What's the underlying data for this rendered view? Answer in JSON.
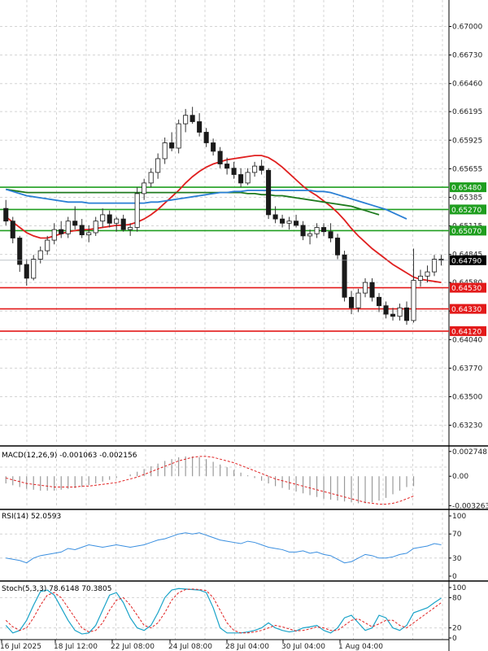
{
  "colors": {
    "bull": "#2e8b57",
    "bear": "#cc1111",
    "ma_red": "#e02020",
    "ma_green": "#1e7a1e",
    "ma_blue": "#2a7fd4",
    "support": "#e31a1a",
    "resistance": "#1f9e1f",
    "macd_hist": "#9a9a9a",
    "macd_signal": "#e02020",
    "rsi_line": "#3a8fe0",
    "stoch_k": "#1aa3c8",
    "stoch_d": "#e02020",
    "grid": "#d4d4d4"
  },
  "chart_data": [
    {
      "type": "candlestick",
      "panel": "price",
      "title": "",
      "price_ticks": [
        "0.67000",
        "0.66730",
        "0.66460",
        "0.66195",
        "0.65925",
        "0.65655",
        "0.65385",
        "0.65115",
        "0.64845",
        "0.64580",
        "0.64310",
        "0.64040",
        "0.63770",
        "0.63500",
        "0.63230"
      ],
      "x_labels": [
        "16 Jul 2025",
        "18 Jul 12:00",
        "22 Jul 08:00",
        "24 Jul 08:00",
        "28 Jul 04:00",
        "30 Jul 04:00",
        "1 Aug 04:00"
      ],
      "current_price": "0.64790",
      "ylim": [
        0.6305,
        0.6725
      ],
      "candles": [
        [
          0.6528,
          0.6536,
          0.6512,
          0.6516
        ],
        [
          0.6516,
          0.652,
          0.6495,
          0.65
        ],
        [
          0.65,
          0.6502,
          0.6468,
          0.6475
        ],
        [
          0.6475,
          0.648,
          0.6455,
          0.6462
        ],
        [
          0.6462,
          0.6484,
          0.646,
          0.648
        ],
        [
          0.648,
          0.6492,
          0.6476,
          0.6488
        ],
        [
          0.6488,
          0.6502,
          0.6484,
          0.6498
        ],
        [
          0.6498,
          0.6514,
          0.6494,
          0.6508
        ],
        [
          0.6508,
          0.6516,
          0.65,
          0.6504
        ],
        [
          0.6504,
          0.652,
          0.65,
          0.6516
        ],
        [
          0.6516,
          0.653,
          0.6508,
          0.6512
        ],
        [
          0.6512,
          0.6518,
          0.65,
          0.6503
        ],
        [
          0.6503,
          0.6512,
          0.6496,
          0.6505
        ],
        [
          0.6505,
          0.652,
          0.6502,
          0.6516
        ],
        [
          0.6516,
          0.6528,
          0.651,
          0.6522
        ],
        [
          0.6522,
          0.6526,
          0.651,
          0.6514
        ],
        [
          0.6514,
          0.652,
          0.6506,
          0.6518
        ],
        [
          0.6518,
          0.6522,
          0.6506,
          0.6508
        ],
        [
          0.6508,
          0.6514,
          0.6502,
          0.651
        ],
        [
          0.651,
          0.6548,
          0.6506,
          0.6542
        ],
        [
          0.6542,
          0.6556,
          0.6536,
          0.6552
        ],
        [
          0.6552,
          0.6566,
          0.6548,
          0.6562
        ],
        [
          0.6562,
          0.658,
          0.6556,
          0.6575
        ],
        [
          0.6575,
          0.6595,
          0.657,
          0.659
        ],
        [
          0.659,
          0.66,
          0.6582,
          0.6585
        ],
        [
          0.6585,
          0.6612,
          0.658,
          0.6608
        ],
        [
          0.6608,
          0.6622,
          0.66,
          0.6616
        ],
        [
          0.6616,
          0.6624,
          0.6608,
          0.661
        ],
        [
          0.661,
          0.6618,
          0.6596,
          0.66
        ],
        [
          0.66,
          0.6604,
          0.6586,
          0.659
        ],
        [
          0.659,
          0.6594,
          0.6578,
          0.6582
        ],
        [
          0.6582,
          0.6586,
          0.6566,
          0.657
        ],
        [
          0.657,
          0.6576,
          0.656,
          0.6566
        ],
        [
          0.6566,
          0.6572,
          0.6556,
          0.656
        ],
        [
          0.656,
          0.6566,
          0.6548,
          0.6552
        ],
        [
          0.6552,
          0.6566,
          0.655,
          0.6562
        ],
        [
          0.6562,
          0.6572,
          0.6558,
          0.6568
        ],
        [
          0.6568,
          0.6574,
          0.656,
          0.6564
        ],
        [
          0.6564,
          0.6566,
          0.6518,
          0.6522
        ],
        [
          0.6522,
          0.653,
          0.6514,
          0.6518
        ],
        [
          0.6518,
          0.6522,
          0.651,
          0.6514
        ],
        [
          0.6514,
          0.652,
          0.6508,
          0.6516
        ],
        [
          0.6516,
          0.6522,
          0.651,
          0.6512
        ],
        [
          0.6512,
          0.6516,
          0.6498,
          0.6502
        ],
        [
          0.6502,
          0.6508,
          0.6494,
          0.6504
        ],
        [
          0.6504,
          0.6514,
          0.65,
          0.651
        ],
        [
          0.651,
          0.6514,
          0.6502,
          0.6506
        ],
        [
          0.6506,
          0.6514,
          0.6496,
          0.65
        ],
        [
          0.65,
          0.6504,
          0.648,
          0.6484
        ],
        [
          0.6484,
          0.6488,
          0.644,
          0.6444
        ],
        [
          0.6444,
          0.645,
          0.6428,
          0.6434
        ],
        [
          0.6434,
          0.6452,
          0.643,
          0.6448
        ],
        [
          0.6448,
          0.6462,
          0.6444,
          0.6458
        ],
        [
          0.6458,
          0.6462,
          0.644,
          0.6444
        ],
        [
          0.6444,
          0.6448,
          0.643,
          0.6436
        ],
        [
          0.6436,
          0.644,
          0.6424,
          0.6428
        ],
        [
          0.6428,
          0.6434,
          0.6422,
          0.6426
        ],
        [
          0.6426,
          0.6438,
          0.6422,
          0.6434
        ],
        [
          0.6434,
          0.644,
          0.6418,
          0.6422
        ],
        [
          0.6422,
          0.649,
          0.642,
          0.646
        ],
        [
          0.646,
          0.647,
          0.6454,
          0.6464
        ],
        [
          0.6464,
          0.6474,
          0.6458,
          0.6468
        ],
        [
          0.6468,
          0.6484,
          0.6464,
          0.648
        ],
        [
          0.648,
          0.6484,
          0.6474,
          0.6479
        ]
      ],
      "moving_averages": [
        {
          "color": "ma_red",
          "values": [
            0.652,
            0.6515,
            0.651,
            0.6505,
            0.6502,
            0.65,
            0.65,
            0.6502,
            0.6504,
            0.6506,
            0.6507,
            0.6508,
            0.6508,
            0.6509,
            0.651,
            0.6511,
            0.6512,
            0.6512,
            0.6513,
            0.6515,
            0.6518,
            0.6522,
            0.6527,
            0.6533,
            0.6539,
            0.6545,
            0.6552,
            0.6558,
            0.6563,
            0.6567,
            0.657,
            0.6572,
            0.6574,
            0.6575,
            0.6576,
            0.6577,
            0.6578,
            0.6578,
            0.6576,
            0.6572,
            0.6567,
            0.6561,
            0.6555,
            0.6549,
            0.6544,
            0.654,
            0.6535,
            0.653,
            0.6524,
            0.6517,
            0.6509,
            0.6502,
            0.6496,
            0.649,
            0.6485,
            0.648,
            0.6475,
            0.6471,
            0.6467,
            0.6463,
            0.6461,
            0.646,
            0.6459,
            0.6458
          ]
        },
        {
          "color": "ma_green",
          "values": [
            0.6546,
            0.6545,
            0.6544,
            0.6543,
            0.6543,
            0.6543,
            0.6543,
            0.6543,
            0.6543,
            0.6543,
            0.6543,
            0.6543,
            0.6543,
            0.6543,
            0.6543,
            0.6543,
            0.6543,
            0.6543,
            0.6543,
            0.6543,
            0.6543,
            0.6543,
            0.6543,
            0.6543,
            0.6543,
            0.6543,
            0.6543,
            0.6543,
            0.6543,
            0.6543,
            0.6543,
            0.6543,
            0.6543,
            0.6543,
            0.6543,
            0.6542,
            0.6542,
            0.6541,
            0.6541,
            0.654,
            0.654,
            0.6539,
            0.6538,
            0.6537,
            0.6536,
            0.6535,
            0.6534,
            0.6533,
            0.6532,
            0.6531,
            0.653,
            0.6528,
            0.6526,
            0.6524,
            0.6522
          ]
        },
        {
          "color": "ma_blue",
          "values": [
            0.6546,
            0.6544,
            0.6542,
            0.654,
            0.6539,
            0.6538,
            0.6537,
            0.6536,
            0.6535,
            0.6534,
            0.6534,
            0.6534,
            0.6533,
            0.6533,
            0.6533,
            0.6533,
            0.6533,
            0.6533,
            0.6533,
            0.6533,
            0.6533,
            0.6534,
            0.6534,
            0.6535,
            0.6536,
            0.6537,
            0.6538,
            0.6539,
            0.654,
            0.6541,
            0.6542,
            0.6543,
            0.6543,
            0.6544,
            0.6544,
            0.6545,
            0.6545,
            0.6545,
            0.6545,
            0.6545,
            0.6545,
            0.6545,
            0.6545,
            0.6545,
            0.6545,
            0.6544,
            0.6544,
            0.6543,
            0.6541,
            0.6539,
            0.6537,
            0.6535,
            0.6533,
            0.6531,
            0.6529,
            0.6527,
            0.6524,
            0.6521,
            0.6518
          ]
        }
      ],
      "levels": [
        {
          "label": "0.65480",
          "value": 0.6548,
          "kind": "resistance"
        },
        {
          "label": "0.65270",
          "value": 0.6527,
          "kind": "resistance"
        },
        {
          "label": "0.65070",
          "value": 0.6507,
          "kind": "resistance"
        },
        {
          "label": "0.64530",
          "value": 0.6453,
          "kind": "support"
        },
        {
          "label": "0.64330",
          "value": 0.6433,
          "kind": "support"
        },
        {
          "label": "0.64120",
          "value": 0.6412,
          "kind": "support"
        }
      ]
    },
    {
      "type": "histogram",
      "panel": "macd",
      "label": "MACD(12,26,9) -0.001063 -0.002156",
      "ticks": [
        "0.002748",
        "0.00",
        "-0.003263"
      ],
      "ylim": [
        -0.0035,
        0.003
      ],
      "histogram": [
        -0.0008,
        -0.001,
        -0.0012,
        -0.0014,
        -0.0015,
        -0.0016,
        -0.0016,
        -0.0016,
        -0.0015,
        -0.0014,
        -0.0013,
        -0.0012,
        -0.001,
        -0.0008,
        -0.0006,
        -0.0004,
        -0.0002,
        0.0,
        0.0002,
        0.0005,
        0.0008,
        0.0011,
        0.0014,
        0.0017,
        0.0019,
        0.0021,
        0.0022,
        0.0022,
        0.0021,
        0.0019,
        0.0016,
        0.0013,
        0.001,
        0.0007,
        0.0004,
        0.0001,
        -0.0002,
        -0.0005,
        -0.0008,
        -0.0011,
        -0.0013,
        -0.0015,
        -0.0017,
        -0.0019,
        -0.0021,
        -0.0023,
        -0.0025,
        -0.0026,
        -0.0027,
        -0.0028,
        -0.0029,
        -0.003,
        -0.003,
        -0.0029,
        -0.0027,
        -0.0024,
        -0.002,
        -0.0016,
        -0.0012,
        -0.0011
      ],
      "signal": [
        -0.0002,
        -0.0004,
        -0.0006,
        -0.0008,
        -0.0009,
        -0.001,
        -0.0011,
        -0.0012,
        -0.0012,
        -0.0012,
        -0.0012,
        -0.0011,
        -0.0011,
        -0.001,
        -0.0009,
        -0.0008,
        -0.0007,
        -0.0005,
        -0.0003,
        -0.0001,
        0.0002,
        0.0005,
        0.0008,
        0.0011,
        0.0014,
        0.0017,
        0.0019,
        0.0021,
        0.0022,
        0.0022,
        0.0021,
        0.0019,
        0.0017,
        0.0015,
        0.0012,
        0.0009,
        0.0006,
        0.0003,
        0.0,
        -0.0003,
        -0.0005,
        -0.0007,
        -0.0009,
        -0.0011,
        -0.0013,
        -0.0015,
        -0.0017,
        -0.0019,
        -0.0021,
        -0.0023,
        -0.0025,
        -0.0027,
        -0.0029,
        -0.003,
        -0.0031,
        -0.0031,
        -0.003,
        -0.0028,
        -0.0025,
        -0.0022
      ]
    },
    {
      "type": "line",
      "panel": "rsi",
      "label": "RSI(14) 52.0593",
      "ticks": [
        "100",
        "70",
        "30",
        "0"
      ],
      "ylim": [
        0,
        100
      ],
      "values": [
        30,
        28,
        26,
        22,
        30,
        34,
        36,
        38,
        40,
        46,
        44,
        48,
        52,
        50,
        48,
        50,
        52,
        50,
        48,
        50,
        52,
        56,
        60,
        62,
        66,
        70,
        72,
        70,
        72,
        68,
        64,
        60,
        58,
        56,
        54,
        58,
        56,
        52,
        48,
        46,
        44,
        40,
        40,
        42,
        38,
        40,
        36,
        34,
        28,
        22,
        24,
        30,
        36,
        34,
        30,
        30,
        32,
        36,
        38,
        46,
        48,
        50,
        54,
        52
      ]
    },
    {
      "type": "line",
      "panel": "stoch",
      "label": "Stoch(5,3,3) 78.6148 70.3805",
      "ticks": [
        "100",
        "80",
        "20",
        "0"
      ],
      "ylim": [
        0,
        100
      ],
      "k": [
        25,
        10,
        15,
        35,
        65,
        92,
        95,
        85,
        60,
        35,
        15,
        8,
        10,
        25,
        55,
        85,
        90,
        70,
        40,
        20,
        15,
        25,
        50,
        80,
        95,
        98,
        97,
        96,
        95,
        90,
        60,
        20,
        10,
        10,
        10,
        12,
        15,
        20,
        30,
        20,
        15,
        12,
        14,
        20,
        22,
        25,
        15,
        10,
        20,
        40,
        45,
        30,
        15,
        20,
        45,
        40,
        20,
        15,
        25,
        50,
        55,
        60,
        70,
        79
      ],
      "d": [
        35,
        22,
        15,
        20,
        40,
        65,
        85,
        90,
        80,
        60,
        40,
        20,
        12,
        15,
        30,
        55,
        75,
        80,
        65,
        45,
        25,
        20,
        30,
        50,
        75,
        90,
        96,
        97,
        96,
        94,
        80,
        55,
        30,
        15,
        10,
        10,
        12,
        15,
        20,
        25,
        22,
        18,
        14,
        15,
        18,
        22,
        20,
        15,
        15,
        25,
        35,
        38,
        30,
        22,
        28,
        35,
        35,
        25,
        20,
        30,
        40,
        50,
        60,
        70
      ]
    }
  ]
}
